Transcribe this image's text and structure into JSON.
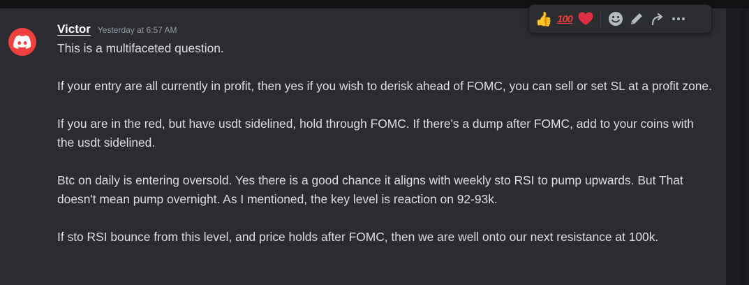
{
  "message": {
    "author": "Victor",
    "timestamp": "Yesterday at 6:57 AM",
    "avatar_icon": "discord-logo-icon",
    "avatar_color": "#ef4040",
    "paragraphs": [
      "This is a multifaceted question.",
      "If your entry are all currently in profit, then yes if you wish to derisk ahead of FOMC, you can sell or set SL at a profit zone.",
      "If you are in the red, but have usdt sidelined, hold through FOMC. If there's a dump after FOMC, add to your coins with the usdt sidelined.",
      "Btc on daily is entering oversold. Yes there is a good chance it aligns with weekly sto RSI to pump upwards. But That doesn't mean pump overnight. As I mentioned, the key level is reaction on 92-93k.",
      "If sto RSI bounce from this level, and price holds after FOMC, then we are well onto our next resistance at 100k."
    ]
  },
  "toolbar": {
    "reactions": [
      {
        "icon": "thumbs-up-icon",
        "glyph": "👍"
      },
      {
        "icon": "hundred-points-icon",
        "glyph": "100"
      },
      {
        "icon": "red-heart-icon",
        "glyph": "❤"
      }
    ],
    "actions": [
      {
        "icon": "add-reaction-icon"
      },
      {
        "icon": "edit-pencil-icon"
      },
      {
        "icon": "forward-arrow-icon"
      },
      {
        "icon": "more-options-icon"
      }
    ]
  }
}
